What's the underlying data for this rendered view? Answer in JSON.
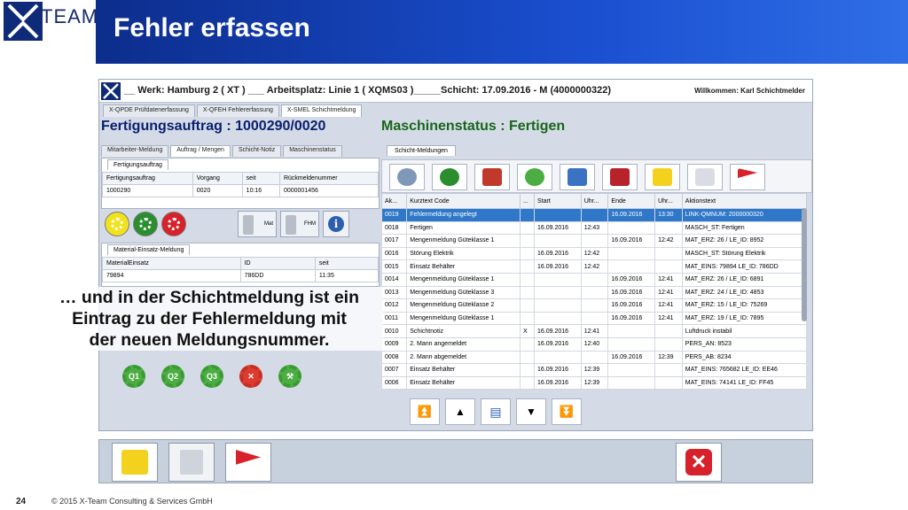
{
  "slide": {
    "logo_text": "TEAM",
    "title": "Fehler erfassen",
    "page_number": "24",
    "copyright": "© 2015  X-Team Consulting & Services GmbH"
  },
  "app": {
    "title": "__ Werk: Hamburg 2 ( XT ) ___ Arbeitsplatz: Linie 1 ( XQMS03 )_____Schicht: 17.09.2016 - M (4000000322)",
    "welcome": "Willkommen: Karl Schichtmelder",
    "tabs": [
      "X-QPDE Prüfdatenerfassung",
      "X-QFEH Fehlererfassung",
      "X-SMEL Schichtmeldung"
    ],
    "order_title": "Fertigungsauftrag : 1000290/0020",
    "machine_status": "Maschinenstatus : Fertigen"
  },
  "left": {
    "sub_tabs": [
      "Mitarbeiter-Meldung",
      "Auftrag / Mengen",
      "Schicht-Notiz",
      "Maschinenstatus"
    ],
    "order_tab": "Fertigungsauftrag",
    "order_headers": [
      "Fertigungsauftrag",
      "Vorgang",
      "seit",
      "Rückmeldenummer"
    ],
    "order_row": [
      "1000290",
      "0020",
      "10:16",
      "0000001456"
    ],
    "buttons": {
      "mat": "Mat",
      "fhm": "FHM"
    },
    "material_tab": "Material-Einsatz-Meldung",
    "material_headers": [
      "MaterialEinsatz",
      "ID",
      "seit"
    ],
    "material_row": [
      "79894",
      "786DD",
      "11:35"
    ],
    "q_buttons": [
      "Q1",
      "Q2",
      "Q3"
    ]
  },
  "overlay": {
    "line1": "… und in der Schichtmeldung ist ein",
    "line2": "Eintrag zu der Fehlermeldung mit",
    "line3": "der neuen Meldungsnummer."
  },
  "right": {
    "tab": "Schicht-Meldungen",
    "headers": [
      "Ak...",
      "Kurztext Code",
      "...",
      "Start",
      "Uhr...",
      "Ende",
      "Uhr...",
      "Aktionstext"
    ],
    "rows": [
      [
        "0019",
        "Fehlermeldung angelegt",
        "",
        "",
        "",
        "16.09.2016",
        "13:30",
        "LINK-QMNUM: 2000000320"
      ],
      [
        "0018",
        "Fertigen",
        "",
        "16.09.2016",
        "12:43",
        "",
        "",
        "MASCH_ST: Fertigen"
      ],
      [
        "0017",
        "Mengenmeldung Güteklasse 1",
        "",
        "",
        "",
        "16.09.2016",
        "12:42",
        "MAT_ERZ: 26 / LE_ID: 8952"
      ],
      [
        "0016",
        "Störung Elektrik",
        "",
        "16.09.2016",
        "12:42",
        "",
        "",
        "MASCH_ST: Störung Elektrik"
      ],
      [
        "0015",
        "Einsatz Behälter",
        "",
        "16.09.2016",
        "12:42",
        "",
        "",
        "MAT_EINS: 79894 LE_ID: 786DD"
      ],
      [
        "0014",
        "Mengenmeldung Güteklasse 1",
        "",
        "",
        "",
        "16.09.2016",
        "12:41",
        "MAT_ERZ: 26 / LE_ID: 6891"
      ],
      [
        "0013",
        "Mengenmeldung Güteklasse 3",
        "",
        "",
        "",
        "16.09.2016",
        "12:41",
        "MAT_ERZ: 24 / LE_ID: 4853"
      ],
      [
        "0012",
        "Mengenmeldung Güteklasse 2",
        "",
        "",
        "",
        "16.09.2016",
        "12:41",
        "MAT_ERZ: 15 / LE_ID: 75269"
      ],
      [
        "0011",
        "Mengenmeldung Güteklasse 1",
        "",
        "",
        "",
        "16.09.2016",
        "12:41",
        "MAT_ERZ: 19 / LE_ID: 7895"
      ],
      [
        "0010",
        "Schichtnotiz",
        "X",
        "16.09.2016",
        "12:41",
        "",
        "",
        "Luftdruck instabil"
      ],
      [
        "0009",
        "2. Mann angemeldet",
        "",
        "16.09.2016",
        "12:40",
        "",
        "",
        "PERS_AN: 8523"
      ],
      [
        "0008",
        "2. Mann abgemeldet",
        "",
        "",
        "",
        "16.09.2016",
        "12:39",
        "PERS_AB: 8234"
      ],
      [
        "0007",
        "Einsatz Behälter",
        "",
        "16.09.2016",
        "12:39",
        "",
        "",
        "MAT_EINS: 765682 LE_ID: EE46"
      ],
      [
        "0006",
        "Einsatz Behälter",
        "",
        "16.09.2016",
        "12:39",
        "",
        "",
        "MAT_EINS: 74141 LE_ID: FF45"
      ]
    ]
  },
  "colors": {
    "header_blue": "#0c2d8c",
    "order_blue": "#0a2070",
    "status_green": "#17661a",
    "selection": "#2f78c9"
  }
}
